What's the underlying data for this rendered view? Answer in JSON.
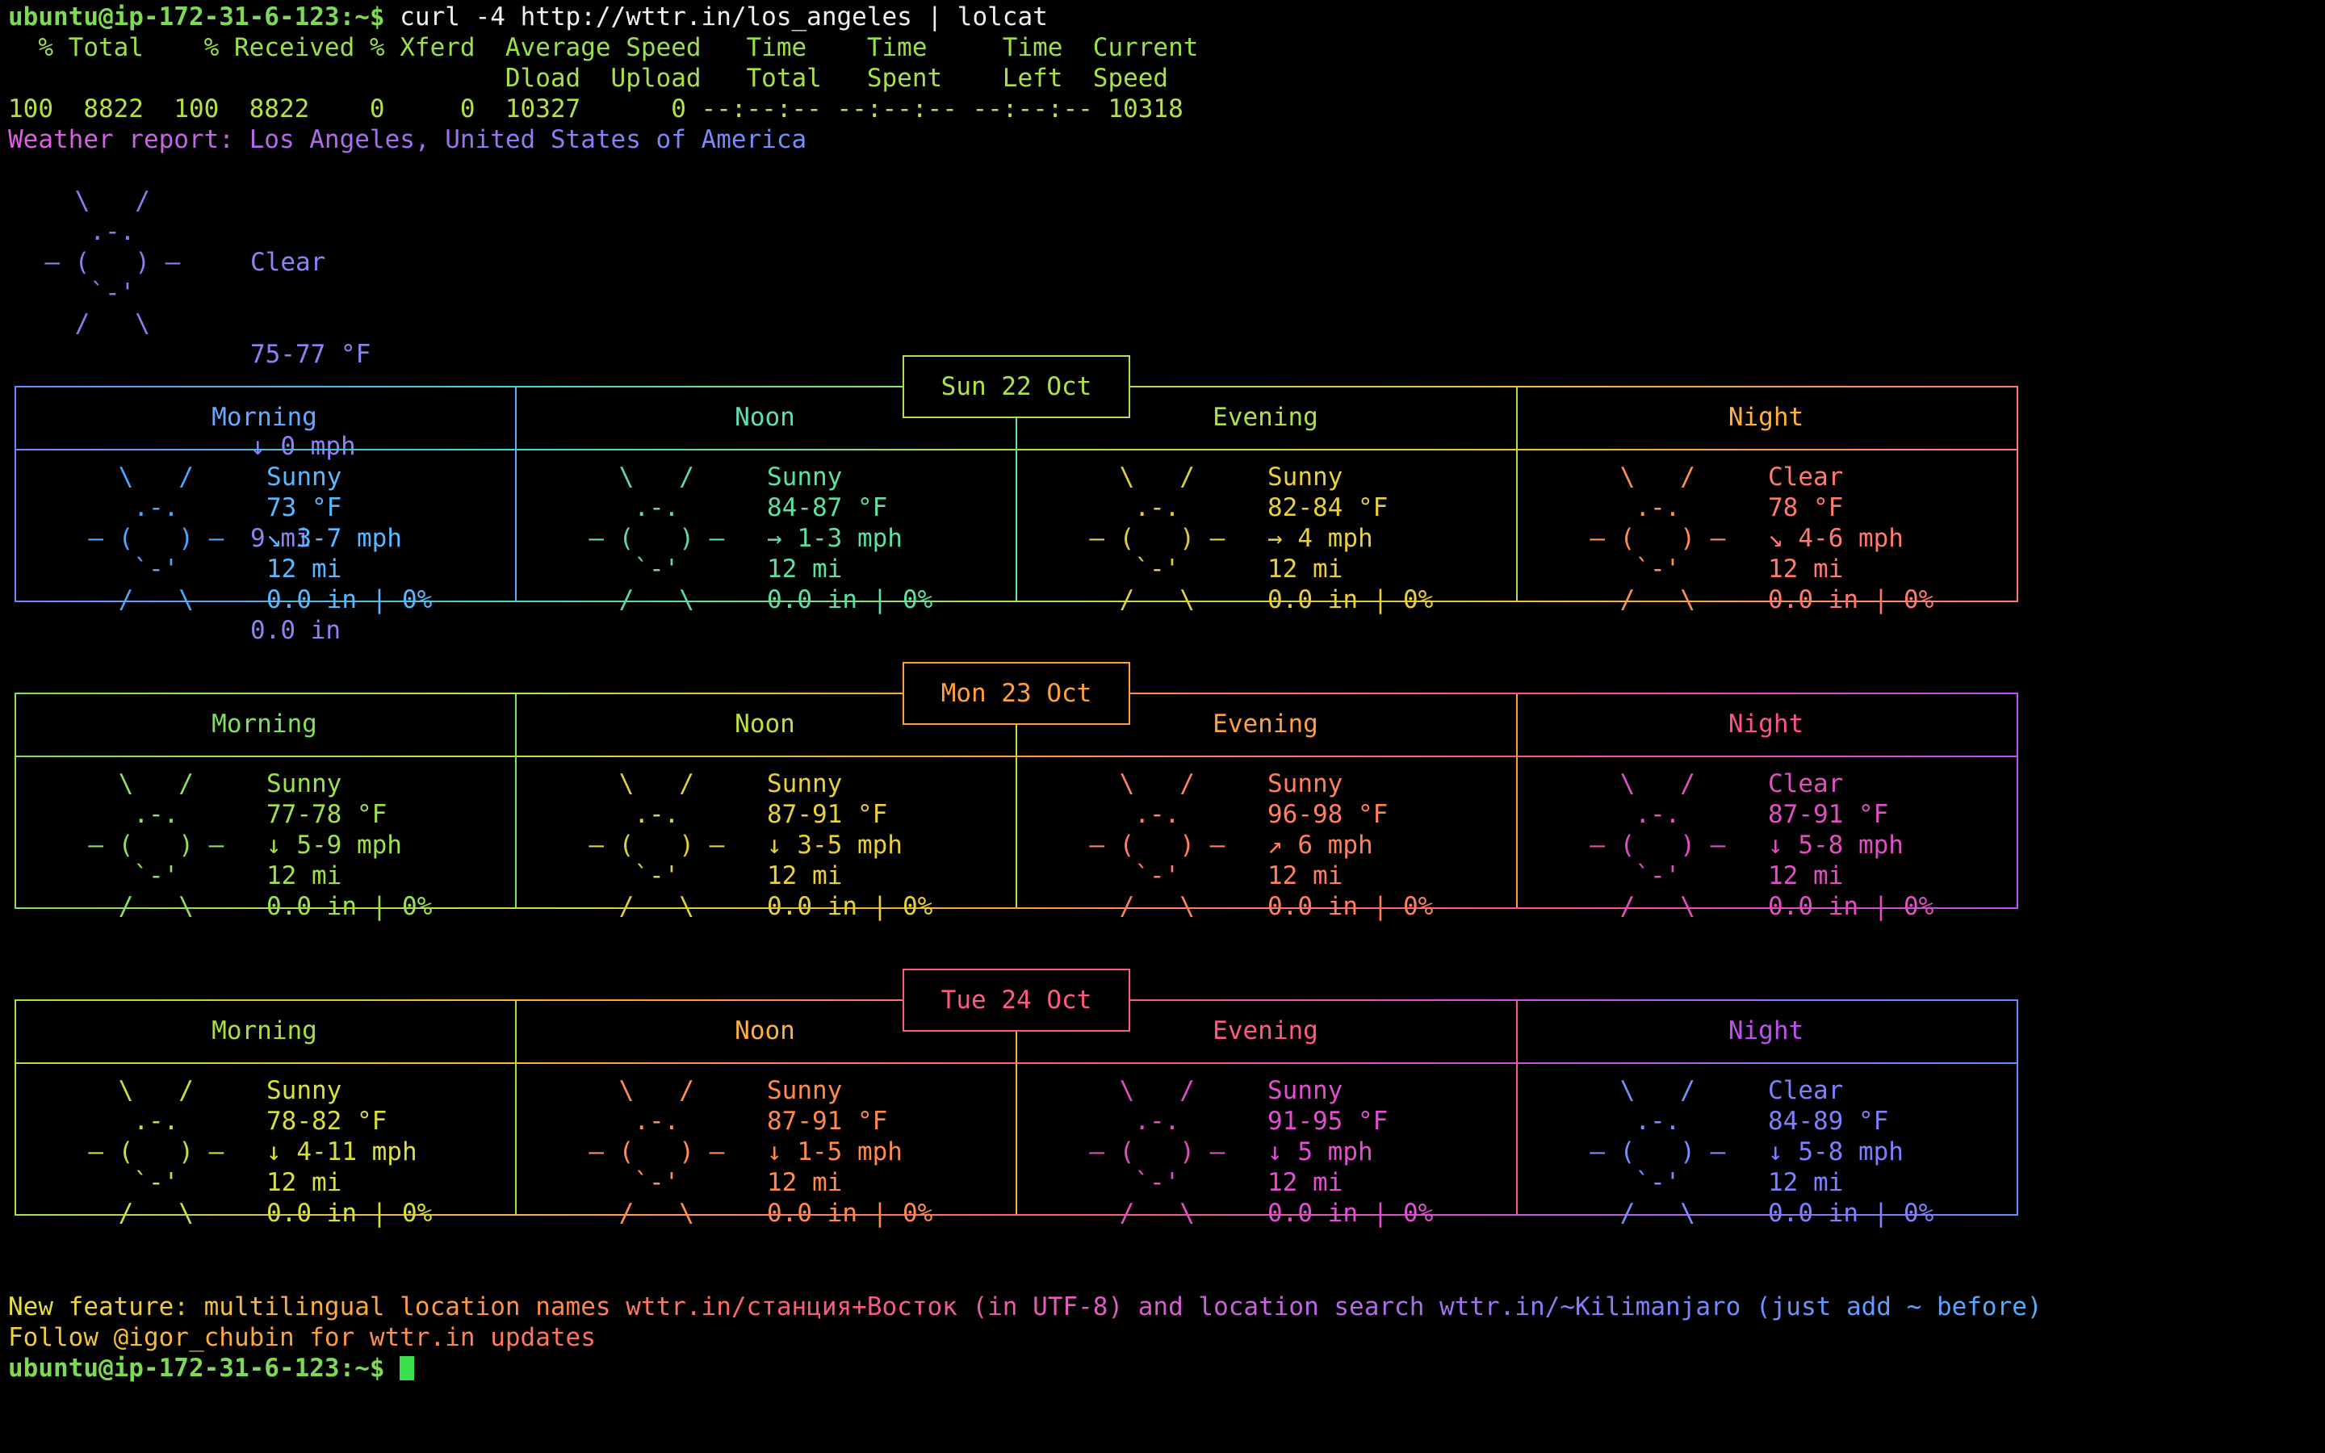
{
  "terminal": {
    "prompt": "ubuntu@ip-172-31-6-123:~$",
    "command": " curl -4 http://wttr.in/los_angeles | lolcat",
    "curl_header1": "  % Total    % Received % Xferd  Average Speed   Time    Time     Time  Current",
    "curl_header2": "                                 Dload  Upload   Total   Spent    Left  Speed",
    "curl_stats": "100  8822  100  8822    0     0  10327      0 --:--:-- --:--:-- --:--:-- 10318",
    "report_title": "Weather report: Los Angeles, United States of America"
  },
  "current": {
    "art": [
      "    \\   /    ",
      "     .-.     ",
      "  ― (   ) ―  ",
      "     `-'     ",
      "    /   \\    "
    ],
    "condition": "Clear",
    "temp": "75-77 °F",
    "wind": "↓ 0 mph",
    "visibility": "9 mi",
    "precip": "0.0 in"
  },
  "periods": [
    "Morning",
    "Noon",
    "Evening",
    "Night"
  ],
  "days": [
    {
      "date": "Sun 22 Oct",
      "cells": [
        {
          "condition": "Sunny",
          "temp": "73 °F",
          "wind": "↘ 3-7 mph",
          "visibility": "12 mi",
          "precip": "0.0 in | 0%"
        },
        {
          "condition": "Sunny",
          "temp": "84-87 °F",
          "wind": "→ 1-3 mph",
          "visibility": "12 mi",
          "precip": "0.0 in | 0%"
        },
        {
          "condition": "Sunny",
          "temp": "82-84 °F",
          "wind": "→ 4 mph",
          "visibility": "12 mi",
          "precip": "0.0 in | 0%"
        },
        {
          "condition": "Clear",
          "temp": "78 °F",
          "wind": "↘ 4-6 mph",
          "visibility": "12 mi",
          "precip": "0.0 in | 0%"
        }
      ]
    },
    {
      "date": "Mon 23 Oct",
      "cells": [
        {
          "condition": "Sunny",
          "temp": "77-78 °F",
          "wind": "↓ 5-9 mph",
          "visibility": "12 mi",
          "precip": "0.0 in | 0%"
        },
        {
          "condition": "Sunny",
          "temp": "87-91 °F",
          "wind": "↓ 3-5 mph",
          "visibility": "12 mi",
          "precip": "0.0 in | 0%"
        },
        {
          "condition": "Sunny",
          "temp": "96-98 °F",
          "wind": "↗ 6 mph",
          "visibility": "12 mi",
          "precip": "0.0 in | 0%"
        },
        {
          "condition": "Clear",
          "temp": "87-91 °F",
          "wind": "↓ 5-8 mph",
          "visibility": "12 mi",
          "precip": "0.0 in | 0%"
        }
      ]
    },
    {
      "date": "Tue 24 Oct",
      "cells": [
        {
          "condition": "Sunny",
          "temp": "78-82 °F",
          "wind": "↓ 4-11 mph",
          "visibility": "12 mi",
          "precip": "0.0 in | 0%"
        },
        {
          "condition": "Sunny",
          "temp": "87-91 °F",
          "wind": "↓ 1-5 mph",
          "visibility": "12 mi",
          "precip": "0.0 in | 0%"
        },
        {
          "condition": "Sunny",
          "temp": "91-95 °F",
          "wind": "↓ 5 mph",
          "visibility": "12 mi",
          "precip": "0.0 in | 0%"
        },
        {
          "condition": "Clear",
          "temp": "84-89 °F",
          "wind": "↓ 5-8 mph",
          "visibility": "12 mi",
          "precip": "0.0 in | 0%"
        }
      ]
    }
  ],
  "footer": {
    "feature_line": "New feature: multilingual location names wttr.in/станция+Восток (in UTF-8) and location search wttr.in/~Kilimanjaro (just add ~ before)",
    "follow_line": "Follow @igor_chubin for wttr.in updates",
    "final_prompt": "ubuntu@ip-172-31-6-123:~$"
  },
  "colors": {
    "background": "#000000",
    "prompt": "#7ed957",
    "cursor": "#39e04a"
  }
}
